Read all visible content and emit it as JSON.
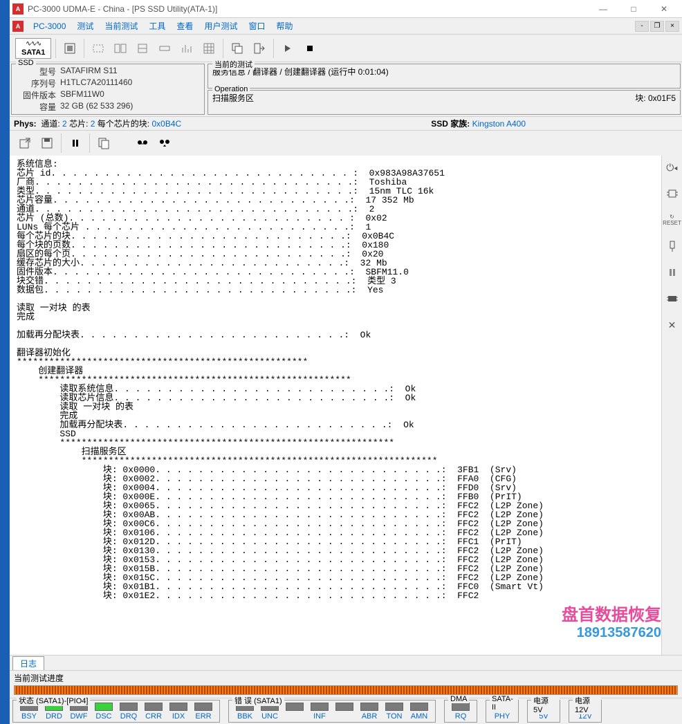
{
  "window": {
    "title": "PC-3000 UDMA-E - China - [PS SSD Utility(ATA-1)]"
  },
  "menu": {
    "appname": "PC-3000",
    "items": [
      "测试",
      "当前测试",
      "工具",
      "查看",
      "用户测试",
      "窗口",
      "帮助"
    ]
  },
  "ssd": {
    "legend": "SSD",
    "model_lbl": "型号",
    "model": "SATAFIRM   S11",
    "serial_lbl": "序列号",
    "serial": "H1TLC7A20111460",
    "fw_lbl": "固件版本",
    "fw": "SBFM11W0",
    "cap_lbl": "容量",
    "cap": "32 GB (62 533 296)"
  },
  "op1": {
    "legend": "当前的测试",
    "line": "服务信息 / 翻译器 / 创建翻译器 (运行中 0:01:04)"
  },
  "op2": {
    "legend": "Operation",
    "left": "扫描服务区",
    "right": "块: 0x01F5"
  },
  "phys": {
    "label": "Phys:",
    "ch_lbl": "通道:",
    "ch": "2",
    "ce_lbl": "芯片:",
    "ce": "2",
    "blk_lbl": "每个芯片的块:",
    "blk": "0x0B4C",
    "fam_lbl": "SSD 家族:",
    "fam": "Kingston A400"
  },
  "log_lines": [
    "系统信息:",
    "芯片 id. . . . . . . . . . . . . . . . . . . . . . . . . . . . :  0x983A98A37651",
    "厂商. . . . . . . . . . . . . . . . . . . . . . . . . . . . . .:  Toshiba",
    "类型. . . . . . . . . . . . . . . . . . . . . . . . . . . . . .:  15nm TLC 16k",
    "芯片容量. . . . . . . . . . . . . . . . . . . . . . . . . . . .:  17 352 Mb",
    "通道. . . . . . . . . . . . . . . . . . . . . . . . . . . . . .:  2",
    "芯片 (总数). . . . . . . . . . . . . . . . . . . . . . . . . . :  0x02",
    "LUNs 每个芯片 . . . . . . . . . . . . . . . . . . . . . . . . .:  1",
    "每个芯片的块. . . . . . . . . . . . . . . . . . . . . . . . . .:  0x0B4C",
    "每个块的页数. . . . . . . . . . . . . . . . . . . . . . . . . .:  0x180",
    "扇区的每个页. . . . . . . . . . . . . . . . . . . . . . . . . .:  0x20",
    "缓存芯片的大小. . . . . . . . . . . . . . . . . . . . . . . . .:  32 Mb",
    "固件版本. . . . . . . . . . . . . . . . . . . . . . . . . . . .:  SBFM11.0",
    "块交错. . . . . . . . . . . . . . . . . . . . . . . . . . . . .:  类型 3",
    "数据包. . . . . . . . . . . . . . . . . . . . . . . . . . . . .:  Yes",
    "",
    "读取 一对块 的表",
    "完成",
    "",
    "加载再分配块表. . . . . . . . . . . . . . . . . . . . . . . . .:  Ok",
    "",
    "翻译器初始化",
    "******************************************************",
    "    创建翻译器",
    "    **********************************************************",
    "        读取系统信息. . . . . . . . . . . . . . . . . . . . . . . . . .:  Ok",
    "        读取芯片信息. . . . . . . . . . . . . . . . . . . . . . . . . .:  Ok",
    "        读取 一对块 的表",
    "        完成",
    "        加载再分配块表. . . . . . . . . . . . . . . . . . . . . . . . .:  Ok",
    "        SSD",
    "        **************************************************************",
    "            扫描服务区",
    "            ******************************************************************",
    "                块: 0x0000. . . . . . . . . . . . . . . . . . . . . . . . . . .:  3FB1  (Srv)",
    "                块: 0x0002. . . . . . . . . . . . . . . . . . . . . . . . . . .:  FFA0  (CFG)",
    "                块: 0x0004. . . . . . . . . . . . . . . . . . . . . . . . . . .:  FFD0  (Srv)",
    "                块: 0x000E. . . . . . . . . . . . . . . . . . . . . . . . . . .:  FFB0  (PrIT)",
    "                块: 0x0065. . . . . . . . . . . . . . . . . . . . . . . . . . .:  FFC2  (L2P Zone)",
    "                块: 0x00AB. . . . . . . . . . . . . . . . . . . . . . . . . . .:  FFC2  (L2P Zone)",
    "                块: 0x00C6. . . . . . . . . . . . . . . . . . . . . . . . . . .:  FFC2  (L2P Zone)",
    "                块: 0x0106. . . . . . . . . . . . . . . . . . . . . . . . . . .:  FFC2  (L2P Zone)",
    "                块: 0x012D. . . . . . . . . . . . . . . . . . . . . . . . . . .:  FFC1  (PrIT)",
    "                块: 0x0130. . . . . . . . . . . . . . . . . . . . . . . . . . .:  FFC2  (L2P Zone)",
    "                块: 0x0153. . . . . . . . . . . . . . . . . . . . . . . . . . .:  FFC2  (L2P Zone)",
    "                块: 0x015B. . . . . . . . . . . . . . . . . . . . . . . . . . .:  FFC2  (L2P Zone)",
    "                块: 0x015C. . . . . . . . . . . . . . . . . . . . . . . . . . .:  FFC2  (L2P Zone)",
    "                块: 0x01B1. . . . . . . . . . . . . . . . . . . . . . . . . . .:  FFC0  (Smart Vt)",
    "                块: 0x01E2. . . . . . . . . . . . . . . . . . . . . . . . . . .:  FFC2"
  ],
  "bottom_tab": "日志",
  "progress_lbl": "当前测试进度",
  "status": {
    "g_state": {
      "legend": "状态 (SATA1)-[PIO4]",
      "leds": [
        {
          "lbl": "BSY",
          "on": false
        },
        {
          "lbl": "DRD",
          "on": true
        },
        {
          "lbl": "DWF",
          "on": false
        },
        {
          "lbl": "DSC",
          "on": true
        },
        {
          "lbl": "DRQ",
          "on": false
        },
        {
          "lbl": "CRR",
          "on": false
        },
        {
          "lbl": "IDX",
          "on": false
        },
        {
          "lbl": "ERR",
          "on": false
        }
      ]
    },
    "g_err": {
      "legend": "错 误 (SATA1)",
      "leds": [
        {
          "lbl": "BBK",
          "on": false
        },
        {
          "lbl": "UNC",
          "on": false
        },
        {
          "lbl": "",
          "on": false
        },
        {
          "lbl": "INF",
          "on": false
        },
        {
          "lbl": "",
          "on": false
        },
        {
          "lbl": "ABR",
          "on": false
        },
        {
          "lbl": "TON",
          "on": false
        },
        {
          "lbl": "AMN",
          "on": false
        }
      ]
    },
    "g_dma": {
      "legend": "DMA",
      "leds": [
        {
          "lbl": "RQ",
          "on": false
        }
      ]
    },
    "g_sata2": {
      "legend": "SATA-II",
      "leds": [
        {
          "lbl": "PHY",
          "on": true
        }
      ]
    },
    "g_5v": {
      "legend": "电源 5V",
      "leds": [
        {
          "lbl": "5V",
          "on": true
        }
      ]
    },
    "g_12v": {
      "legend": "电源 12V",
      "leds": [
        {
          "lbl": "12V",
          "on": true
        }
      ]
    }
  },
  "watermark": {
    "t1": "盘首数据恢复",
    "t2": "18913587620"
  }
}
